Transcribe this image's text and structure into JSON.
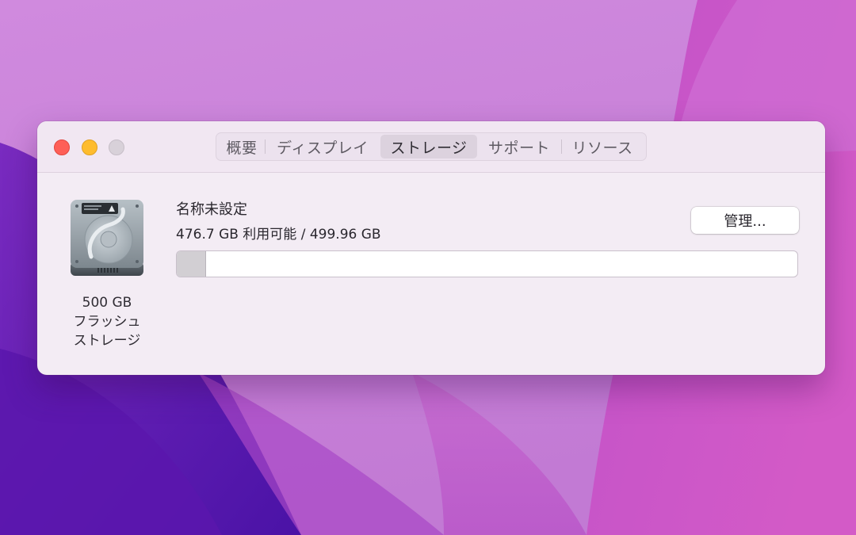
{
  "window": {
    "tabs": [
      {
        "label": "概要",
        "selected": false
      },
      {
        "label": "ディスプレイ",
        "selected": false
      },
      {
        "label": "ストレージ",
        "selected": true
      },
      {
        "label": "サポート",
        "selected": false
      },
      {
        "label": "リソース",
        "selected": false
      }
    ]
  },
  "storage": {
    "drive_icon": "hard-drive-icon",
    "drive_size_label": "500 GB",
    "drive_type_line1": "フラッシュ",
    "drive_type_line2": "ストレージ",
    "volume_name": "名称未設定",
    "capacity_text": "476.7 GB 利用可能 / 499.96 GB",
    "used_fraction": 0.0465,
    "manage_button_label": "管理..."
  },
  "colors": {
    "close": "#fe5f57",
    "minimize": "#febc2e",
    "zoom_disabled": "#d8d1d9",
    "used_segment": "#d2cfd3"
  }
}
